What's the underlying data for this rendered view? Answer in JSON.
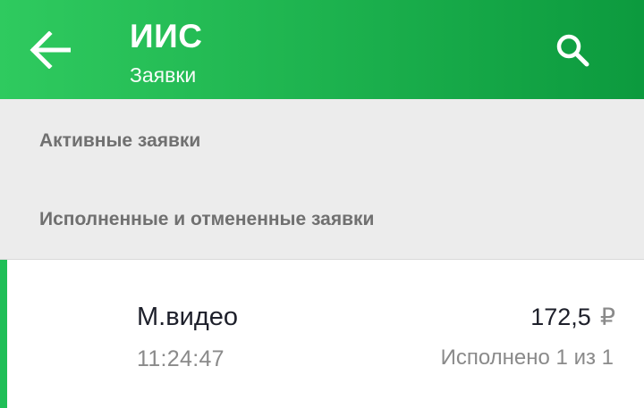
{
  "header": {
    "title": "ИИС",
    "subtitle": "Заявки",
    "back_icon": "arrow-left-icon",
    "search_icon": "search-icon",
    "colors": {
      "gradient_start": "#2fca5f",
      "gradient_end": "#0c9a3e",
      "text": "#ffffff"
    }
  },
  "sections": {
    "active_label": "Активные заявки",
    "completed_label": "Исполненные и отмененные заявки"
  },
  "orders": [
    {
      "name": "М.видео",
      "time": "11:24:47",
      "price": "172,5",
      "currency": "₽",
      "status": "Исполнено 1 из 1",
      "accent_color": "#1fbf57"
    }
  ]
}
